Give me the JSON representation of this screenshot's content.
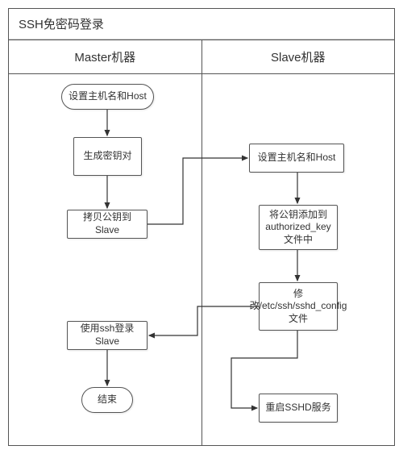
{
  "title": "SSH免密码登录",
  "columns": {
    "left": "Master机器",
    "right": "Slave机器"
  },
  "nodes": {
    "m1": "设置主机名和Host",
    "m2": "生成密钥对",
    "m3": "拷贝公钥到Slave",
    "m4": "使用ssh登录Slave",
    "m5": "结束",
    "s1": "设置主机名和Host",
    "s2": "将公钥添加到authorized_key文件中",
    "s3": "修改/etc/ssh/sshd_config文件",
    "s4": "重启SSHD服务"
  }
}
